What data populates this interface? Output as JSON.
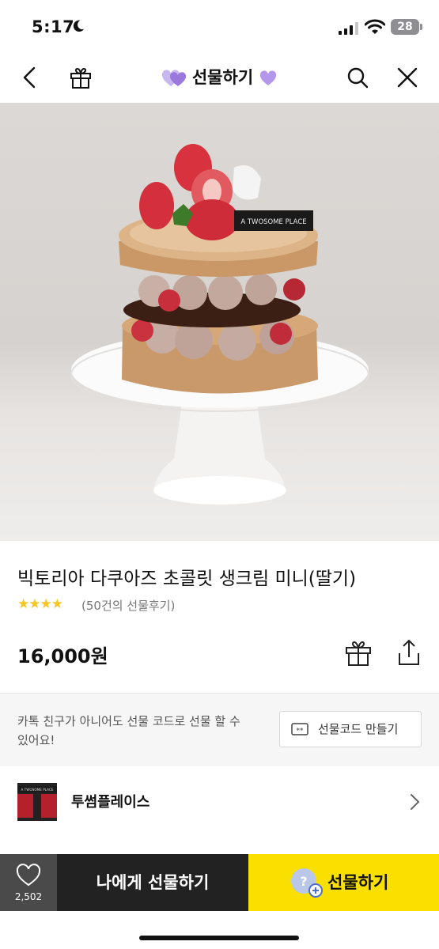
{
  "status": {
    "time": "5:17",
    "battery": "28"
  },
  "nav": {
    "title": "선물하기"
  },
  "hero": {
    "brand_plate": "A TWOSOME PLACE"
  },
  "product": {
    "title": "빅토리아 다쿠아즈 초콜릿 생크림 미니(딸기)",
    "stars": "★★★★",
    "reviews": "(50건의 선물후기)",
    "price": "16,000원"
  },
  "giftcode": {
    "text": "카톡 친구가 아니어도 선물 코드로 선물 할 수 있어요!",
    "button_label": "선물코드 만들기",
    "button_icon_text": "**"
  },
  "brand": {
    "name": "투썸플레이스",
    "logo_text": "A TWOSOME PLACE"
  },
  "bottom": {
    "like_count": "2,502",
    "self_gift_label": "나에게 선물하기",
    "gift_label": "선물하기"
  },
  "colors": {
    "accent_yellow": "#f9e000",
    "star": "#f4c621",
    "heart_purple": "#a07be0"
  }
}
